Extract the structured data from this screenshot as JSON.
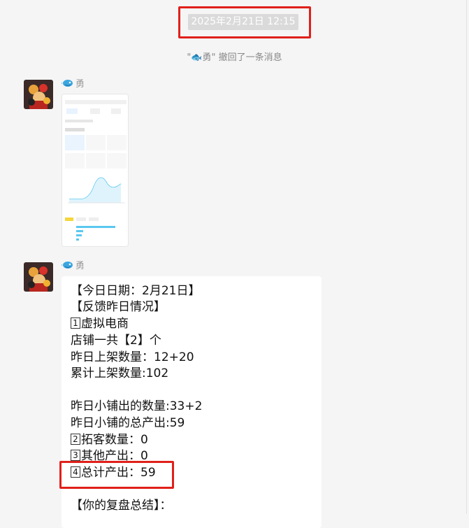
{
  "conversation": {
    "timestamp": "2025年2月21日 12:15",
    "system_message": "\"🐟勇\" 撤回了一条消息",
    "sender_name": "勇"
  },
  "messages": [
    {
      "type": "image",
      "thumbnail": {
        "title": "Phone screenshot of sales statistics dashboard with cards and a line chart"
      }
    },
    {
      "type": "text",
      "lines": [
        "【今日日期：2月21日】",
        "【反馈昨日情况】",
        "虚拟电商",
        "店铺一共【2】个",
        "昨日上架数量：12+20",
        "累计上架数量:102",
        "",
        "昨日小铺出的数量:33+2",
        "昨日小铺的总产出:59",
        "拓客数量：0",
        "其他产出：0",
        "总计产出：59",
        "",
        "【你的复盘总结】："
      ],
      "num_badges": [
        "1",
        "2",
        "3",
        "4"
      ]
    }
  ],
  "colors": {
    "highlight_border": "#e0201a",
    "background": "#f5f5f5",
    "bubble": "#ffffff",
    "timestamp_bg": "#dadada"
  }
}
